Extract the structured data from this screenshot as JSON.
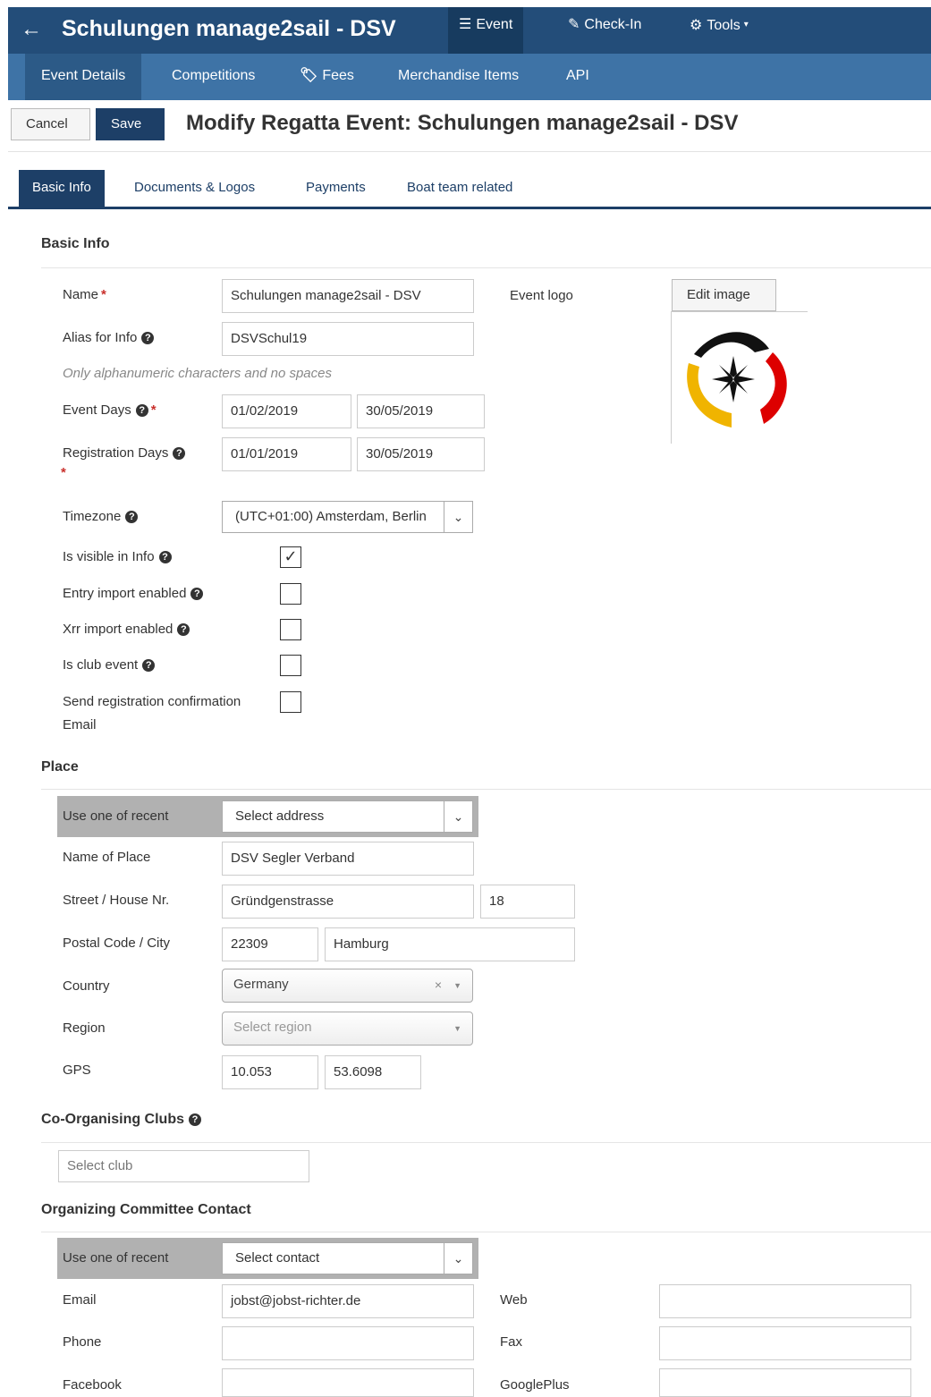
{
  "topbar": {
    "back_icon": "←",
    "title": "Schulungen manage2sail - DSV",
    "nav": [
      {
        "label": "Event",
        "icon": "☰"
      },
      {
        "label": "Check-In",
        "icon": "✎"
      },
      {
        "label": "Tools",
        "icon": "⚙",
        "caret": "▾"
      }
    ]
  },
  "subnav": [
    {
      "label": "Event Details"
    },
    {
      "label": "Competitions"
    },
    {
      "label": "Fees",
      "icon": "🏷"
    },
    {
      "label": "Merchandise Items"
    },
    {
      "label": "API"
    }
  ],
  "actions": {
    "cancel": "Cancel",
    "save": "Save",
    "heading": "Modify Regatta Event: Schulungen manage2sail - DSV"
  },
  "tabs": [
    "Basic Info",
    "Documents & Logos",
    "Payments",
    "Boat team related"
  ],
  "basic": {
    "section_title": "Basic Info",
    "name_label": "Name",
    "name_value": "Schulungen manage2sail - DSV",
    "alias_label": "Alias for Info",
    "alias_value": "DSVSchul19",
    "alias_hint": "Only alphanumeric characters and no spaces",
    "event_days_label": "Event Days",
    "event_days_from": "01/02/2019",
    "event_days_to": "30/05/2019",
    "reg_days_label": "Registration Days",
    "reg_days_from": "01/01/2019",
    "reg_days_to": "30/05/2019",
    "timezone_label": "Timezone",
    "timezone_value": "(UTC+01:00) Amsterdam, Berlin",
    "event_logo_label": "Event logo",
    "edit_image": "Edit image",
    "checkboxes": [
      {
        "label": "Is visible in Info",
        "checked": true,
        "mark": "✓"
      },
      {
        "label": "Entry import enabled",
        "checked": false,
        "mark": ""
      },
      {
        "label": "Xrr import enabled",
        "checked": false,
        "mark": ""
      },
      {
        "label": "Is club event",
        "checked": false,
        "mark": ""
      },
      {
        "label": "Send registration confirmation",
        "label2": "Email",
        "checked": false,
        "mark": ""
      }
    ],
    "required_mark": "*",
    "help_icon": "?"
  },
  "place": {
    "section_title": "Place",
    "recent_label": "Use one of recent",
    "recent_select": "Select address",
    "name_label": "Name of Place",
    "name_value": "DSV Segler Verband",
    "street_label": "Street / House Nr.",
    "street_value": "Gründgenstrasse",
    "house_value": "18",
    "postal_label": "Postal Code / City",
    "postal_value": "22309",
    "city_value": "Hamburg",
    "country_label": "Country",
    "country_value": "Germany",
    "region_label": "Region",
    "region_placeholder": "Select region",
    "gps_label": "GPS",
    "gps_lon": "10.053",
    "gps_lat": "53.6098"
  },
  "coorg": {
    "section_title": "Co-Organising Clubs",
    "placeholder": "Select club"
  },
  "contact": {
    "section_title": "Organizing Committee Contact",
    "recent_label": "Use one of recent",
    "recent_select": "Select contact",
    "email_label": "Email",
    "email_value": "jobst@jobst-richter.de",
    "phone_label": "Phone",
    "phone_value": "",
    "facebook_label": "Facebook",
    "facebook_value": "",
    "web_label": "Web",
    "web_value": "",
    "fax_label": "Fax",
    "fax_value": "",
    "googleplus_label": "GooglePlus",
    "googleplus_value": ""
  },
  "colors": {
    "topbar": "#234d79",
    "subbar": "#3e73a6",
    "primary": "#1d3f67",
    "logo_black": "#111111",
    "logo_red": "#dd0000",
    "logo_gold": "#f0b400"
  },
  "icons": {
    "dropdown": "⌄",
    "clear": "×",
    "select_arrow": "▼"
  }
}
